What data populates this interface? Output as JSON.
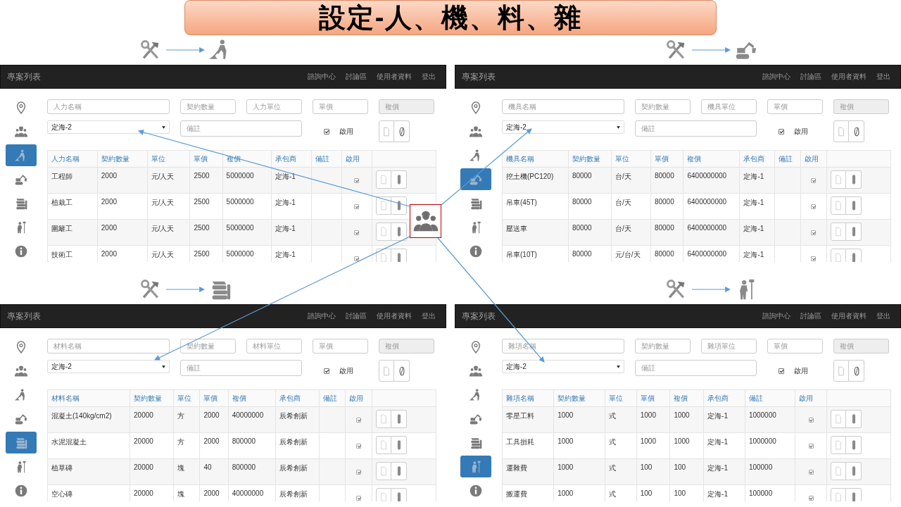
{
  "slide": {
    "title": "設定-人、機、料、雜"
  },
  "panels": [
    {
      "navbar": {
        "brand": "專案列表",
        "links": [
          "諮詢中心",
          "討論區",
          "使用者資料",
          "登出"
        ]
      },
      "sidebar": [
        {
          "kind": "location",
          "selected": false
        },
        {
          "kind": "crew",
          "selected": false
        },
        {
          "kind": "labor",
          "selected": true
        },
        {
          "kind": "machine",
          "selected": false
        },
        {
          "kind": "material",
          "selected": false
        },
        {
          "kind": "misc",
          "selected": false
        },
        {
          "kind": "info",
          "selected": false
        }
      ],
      "form": {
        "fields": [
          {
            "placeholder": "人力名稱",
            "disabled": false
          },
          {
            "placeholder": "契約數量",
            "disabled": false
          },
          {
            "placeholder": "人力單位",
            "disabled": false
          },
          {
            "placeholder": "單價",
            "disabled": false
          },
          {
            "placeholder": "複價",
            "disabled": true
          }
        ],
        "contractor_select": {
          "value": "定海-2"
        },
        "remark_field": {
          "placeholder": "備註"
        },
        "enabled_checkbox": {
          "label": "啟用",
          "checked": true
        }
      },
      "table": {
        "columns": [
          "人力名稱",
          "契約數量",
          "單位",
          "單價",
          "複價",
          "承包商",
          "備註",
          "啟用"
        ],
        "rows": [
          {
            "name": "工程師",
            "quantity": "2000",
            "unit": "元/人天",
            "price": "2500",
            "total": "5000000",
            "contractor": "定海-1",
            "enabled": true
          },
          {
            "name": "植栽工",
            "quantity": "2000",
            "unit": "元/人天",
            "price": "2500",
            "total": "5000000",
            "contractor": "定海-1",
            "enabled": true
          },
          {
            "name": "圍籬工",
            "quantity": "2000",
            "unit": "元/人天",
            "price": "2500",
            "total": "5000000",
            "contractor": "定海-1",
            "enabled": true
          },
          {
            "name": "技術工",
            "quantity": "2000",
            "unit": "元/人天",
            "price": "2500",
            "total": "5000000",
            "contractor": "定海-1",
            "enabled": true
          }
        ]
      }
    },
    {
      "navbar": {
        "brand": "專案列表",
        "links": [
          "諮詢中心",
          "討論區",
          "使用者資料",
          "登出"
        ]
      },
      "sidebar": [
        {
          "kind": "location",
          "selected": false
        },
        {
          "kind": "crew",
          "selected": false
        },
        {
          "kind": "labor",
          "selected": false
        },
        {
          "kind": "machine",
          "selected": true
        },
        {
          "kind": "material",
          "selected": false
        },
        {
          "kind": "misc",
          "selected": false
        },
        {
          "kind": "info",
          "selected": false
        }
      ],
      "form": {
        "fields": [
          {
            "placeholder": "機具名稱",
            "disabled": false
          },
          {
            "placeholder": "契約數量",
            "disabled": false
          },
          {
            "placeholder": "機具單位",
            "disabled": false
          },
          {
            "placeholder": "單價",
            "disabled": false
          },
          {
            "placeholder": "複價",
            "disabled": true
          }
        ],
        "contractor_select": {
          "value": "定海-2"
        },
        "remark_field": {
          "placeholder": "備註"
        },
        "enabled_checkbox": {
          "label": "啟用",
          "checked": true
        }
      },
      "table": {
        "columns": [
          "機具名稱",
          "契約數量",
          "單位",
          "單價",
          "複價",
          "承包商",
          "備註",
          "啟用"
        ],
        "rows": [
          {
            "name": "挖土機(PC120)",
            "quantity": "80000",
            "unit": "台/天",
            "price": "80000",
            "total": "6400000000",
            "contractor": "定海-1",
            "enabled": true
          },
          {
            "name": "吊車(45T)",
            "quantity": "80000",
            "unit": "台/天",
            "price": "80000",
            "total": "6400000000",
            "contractor": "定海-1",
            "enabled": true
          },
          {
            "name": "壓送車",
            "quantity": "80000",
            "unit": "台/天",
            "price": "80000",
            "total": "6400000000",
            "contractor": "定海-1",
            "enabled": true
          },
          {
            "name": "吊車(10T)",
            "quantity": "80000",
            "unit": "元/台/天",
            "price": "80000",
            "total": "6400000000",
            "contractor": "定海-1",
            "enabled": true
          }
        ]
      }
    },
    {
      "navbar": {
        "brand": "專案列表",
        "links": [
          "諮詢中心",
          "討論區",
          "使用者資料",
          "登出"
        ]
      },
      "sidebar": [
        {
          "kind": "location",
          "selected": false
        },
        {
          "kind": "crew",
          "selected": false
        },
        {
          "kind": "labor",
          "selected": false
        },
        {
          "kind": "machine",
          "selected": false
        },
        {
          "kind": "material",
          "selected": true
        },
        {
          "kind": "misc",
          "selected": false
        },
        {
          "kind": "info",
          "selected": false
        }
      ],
      "form": {
        "fields": [
          {
            "placeholder": "材料名稱",
            "disabled": false
          },
          {
            "placeholder": "契約數量",
            "disabled": false
          },
          {
            "placeholder": "材料單位",
            "disabled": false
          },
          {
            "placeholder": "單價",
            "disabled": false
          },
          {
            "placeholder": "複價",
            "disabled": true
          }
        ],
        "contractor_select": {
          "value": "定海-2"
        },
        "remark_field": {
          "placeholder": "備註"
        },
        "enabled_checkbox": {
          "label": "啟用",
          "checked": true
        }
      },
      "table": {
        "columns": [
          "材料名稱",
          "契約數量",
          "單位",
          "單價",
          "複價",
          "承包商",
          "備註",
          "啟用"
        ],
        "rows": [
          {
            "name": "混凝土(140kg/cm2)",
            "quantity": "20000",
            "unit": "方",
            "price": "2000",
            "total": "40000000",
            "contractor": "辰希創新",
            "enabled": true
          },
          {
            "name": "水泥混凝土",
            "quantity": "20000",
            "unit": "方",
            "price": "2000",
            "total": "800000",
            "contractor": "辰希創新",
            "enabled": true
          },
          {
            "name": "植草磚",
            "quantity": "20000",
            "unit": "塊",
            "price": "40",
            "total": "800000",
            "contractor": "辰希創新",
            "enabled": true
          },
          {
            "name": "空心磚",
            "quantity": "20000",
            "unit": "塊",
            "price": "2000",
            "total": "40000000",
            "contractor": "辰希創新",
            "enabled": true
          }
        ]
      }
    },
    {
      "navbar": {
        "brand": "專案列表",
        "links": [
          "諮詢中心",
          "討論區",
          "使用者資料",
          "登出"
        ]
      },
      "sidebar": [
        {
          "kind": "location",
          "selected": false
        },
        {
          "kind": "crew",
          "selected": false
        },
        {
          "kind": "labor",
          "selected": false
        },
        {
          "kind": "machine",
          "selected": false
        },
        {
          "kind": "material",
          "selected": false
        },
        {
          "kind": "misc",
          "selected": true
        },
        {
          "kind": "info",
          "selected": false
        }
      ],
      "form": {
        "fields": [
          {
            "placeholder": "雜項名稱",
            "disabled": false
          },
          {
            "placeholder": "契約數量",
            "disabled": false
          },
          {
            "placeholder": "雜項單位",
            "disabled": false
          },
          {
            "placeholder": "單價",
            "disabled": false
          },
          {
            "placeholder": "複價",
            "disabled": true
          }
        ],
        "contractor_select": {
          "value": "定海-2"
        },
        "remark_field": {
          "placeholder": "備註"
        },
        "enabled_checkbox": {
          "label": "啟用",
          "checked": true
        }
      },
      "table": {
        "columns": [
          "雜項名稱",
          "契約數量",
          "單位",
          "單價",
          "複價",
          "承包商",
          "備註",
          "啟用"
        ],
        "rows": [
          {
            "name": "零星工料",
            "quantity": "1000",
            "unit": "式",
            "price": "1000",
            "total": "1000",
            "contractor": "定海-1",
            "remark": "1000000",
            "enabled": true
          },
          {
            "name": "工具損耗",
            "quantity": "1000",
            "unit": "式",
            "price": "1000",
            "total": "1000",
            "contractor": "定海-1",
            "remark": "1000000",
            "enabled": true
          },
          {
            "name": "運雜費",
            "quantity": "1000",
            "unit": "式",
            "price": "100",
            "total": "100",
            "contractor": "定海-1",
            "remark": "100000",
            "enabled": true
          },
          {
            "name": "搬運費",
            "quantity": "1000",
            "unit": "式",
            "price": "100",
            "total": "100",
            "contractor": "定海-1",
            "remark": "100000",
            "enabled": true
          }
        ]
      }
    }
  ]
}
